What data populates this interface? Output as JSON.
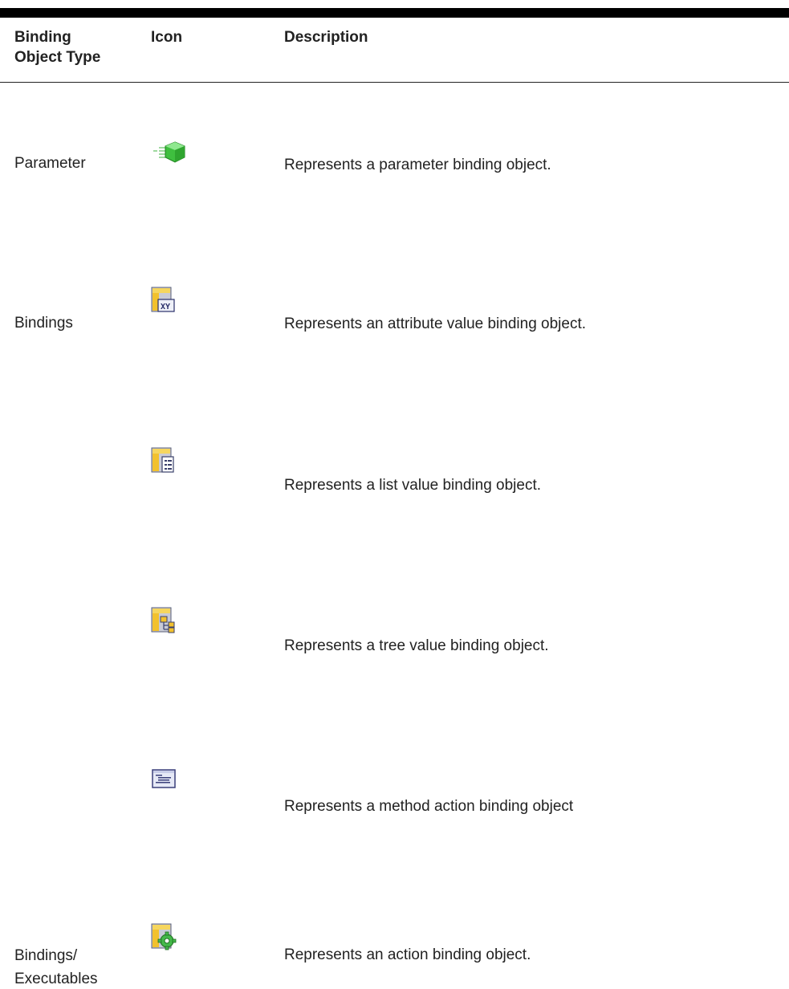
{
  "table": {
    "headers": {
      "type": "Binding Object Type",
      "type_line1": "Binding",
      "type_line2": "Object Type",
      "icon": "Icon",
      "description": "Description"
    },
    "rows": [
      {
        "type_line1": "Parameter",
        "type_line2": "",
        "icon": "parameter-binding-icon",
        "description": "Represents a parameter binding object."
      },
      {
        "type_line1": "Bindings",
        "type_line2": "",
        "icon": "attribute-value-binding-icon",
        "description": "Represents an attribute value binding object."
      },
      {
        "type_line1": "",
        "type_line2": "",
        "icon": "list-value-binding-icon",
        "description": "Represents a list value binding object."
      },
      {
        "type_line1": "",
        "type_line2": "",
        "icon": "tree-value-binding-icon",
        "description": "Represents a tree value binding object."
      },
      {
        "type_line1": "",
        "type_line2": "",
        "icon": "method-action-binding-icon",
        "description": "Represents a method action binding object"
      },
      {
        "type_line1": "Bindings/",
        "type_line2": "Executables",
        "icon": "action-binding-icon",
        "description": "Represents an action binding object."
      }
    ]
  },
  "colors": {
    "rule": "#000000",
    "text": "#222222",
    "folder_yellow": "#f2c12e",
    "gem_green": "#3fbf3f",
    "panel_gray": "#c9cbd6"
  }
}
